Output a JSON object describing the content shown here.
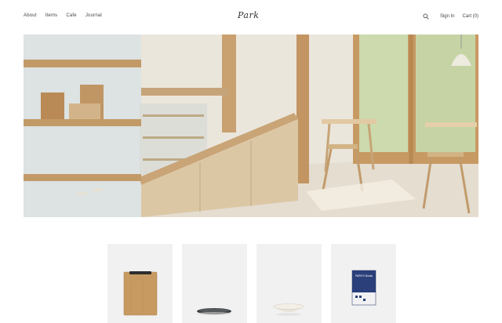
{
  "nav": {
    "items": [
      {
        "label": "About"
      },
      {
        "label": "Items"
      },
      {
        "label": "Cafe"
      },
      {
        "label": "Journal"
      }
    ]
  },
  "brand": {
    "logo_text": "Park"
  },
  "header_right": {
    "search_icon": "search-icon",
    "signin_label": "Sign In",
    "cart_label": "Cart (0)"
  },
  "hero": {
    "image": "cafe-interior-photo"
  },
  "products": [
    {
      "name": "clipboard"
    },
    {
      "name": "plate"
    },
    {
      "name": "bowl"
    },
    {
      "name": "book",
      "cover_text": "PARK'S Books"
    }
  ],
  "colors": {
    "background": "#ffffff",
    "text": "#333333",
    "product_bg": "#f1f1f1",
    "wood": "#c8a878"
  }
}
